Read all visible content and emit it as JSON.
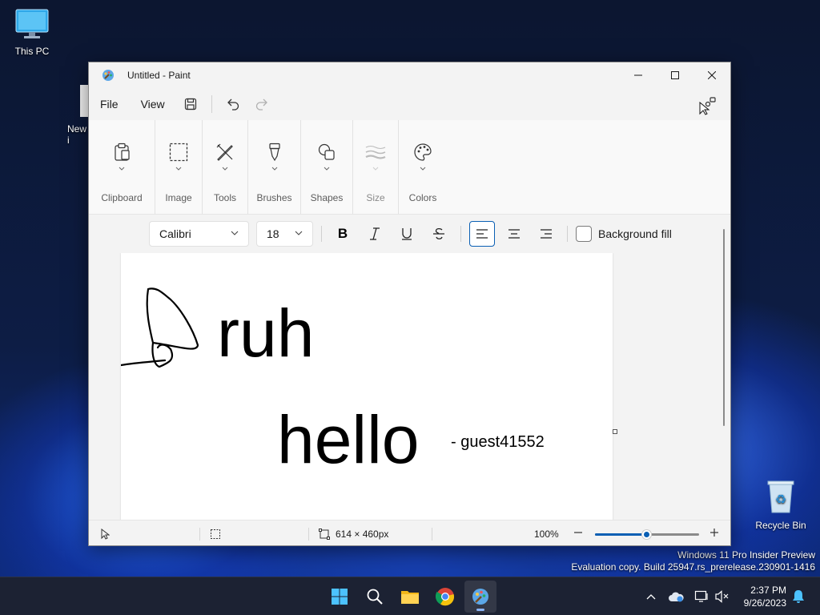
{
  "desktop": {
    "icons": [
      {
        "label": "This PC"
      },
      {
        "label": "New\ni"
      },
      {
        "label": "Recycle Bin"
      }
    ],
    "watermark": {
      "line1": "Windows 11 Pro Insider Preview",
      "line2": "Evaluation copy. Build 25947.rs_prerelease.230901-1416"
    }
  },
  "window": {
    "title": "Untitled - Paint",
    "menu": {
      "file": "File",
      "view": "View"
    },
    "ribbon": {
      "groups": [
        {
          "label": "Clipboard"
        },
        {
          "label": "Image"
        },
        {
          "label": "Tools"
        },
        {
          "label": "Brushes"
        },
        {
          "label": "Shapes"
        },
        {
          "label": "Size"
        },
        {
          "label": "Colors"
        }
      ]
    },
    "text_toolbar": {
      "font": "Calibri",
      "size": "18",
      "background_fill": "Background fill"
    },
    "canvas": {
      "texts": {
        "ruh": "ruh",
        "hello": "hello",
        "signature": "- guest41552"
      }
    },
    "status": {
      "dimensions": "614 × 460px",
      "zoom": "100%",
      "zoom_level": 0.5
    }
  },
  "taskbar": {
    "time": "2:37 PM",
    "date": "9/26/2023"
  },
  "colors": {
    "accent": "#0a5fb4",
    "taskbar": "#1c2233"
  }
}
